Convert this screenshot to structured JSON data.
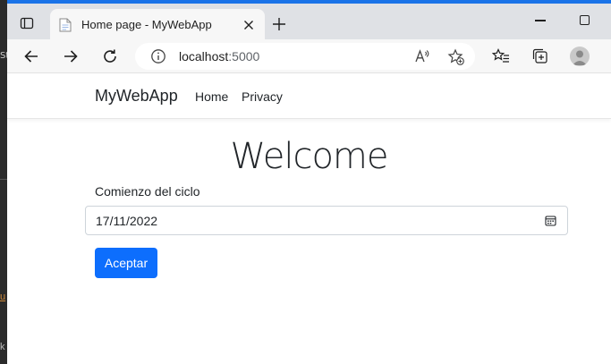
{
  "background_window": {
    "fragment_top": "St",
    "fragment_mid": "u",
    "fragment_bottom": "k"
  },
  "browser": {
    "tab": {
      "title": "Home page - MyWebApp",
      "favicon": "page-icon"
    },
    "address_bar": {
      "host": "localhost",
      "port": ":5000"
    },
    "colors": {
      "accent": "#1a73e8",
      "tab_strip": "#dfe1e5",
      "toolbar": "#f7f7f7"
    }
  },
  "page": {
    "navbar": {
      "brand": "MyWebApp",
      "links": [
        {
          "label": "Home"
        },
        {
          "label": "Privacy"
        }
      ]
    },
    "heading": "Welcome",
    "form": {
      "label": "Comienzo del ciclo",
      "date_value": "17/11/2022",
      "submit_label": "Aceptar"
    },
    "colors": {
      "primary_button": "#0d6efd",
      "text": "#212529",
      "input_border": "#ced4da"
    }
  }
}
